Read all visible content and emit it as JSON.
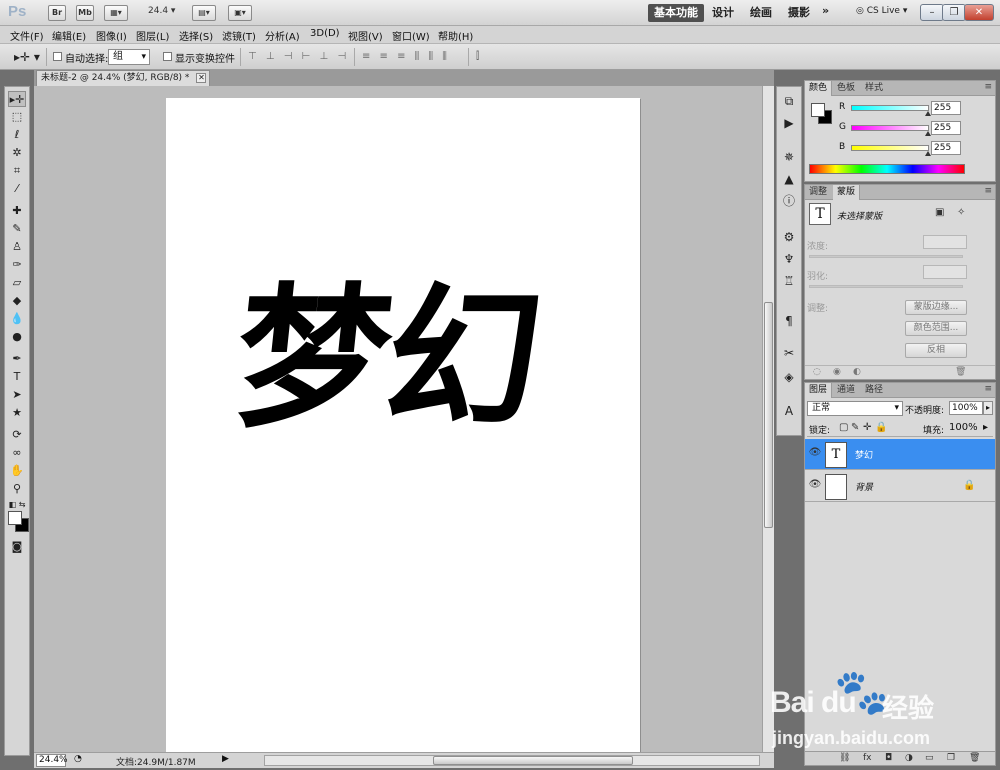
{
  "app": {
    "logo": "Ps",
    "bridge_btn": "Br",
    "minibridge_btn": "Mb",
    "zoom_select": "24.4",
    "workspaces": [
      {
        "label": "基本功能",
        "active": true
      },
      {
        "label": "设计",
        "active": false
      },
      {
        "label": "绘画",
        "active": false
      },
      {
        "label": "摄影",
        "active": false
      }
    ],
    "more": "»",
    "cs_live": "CS Live"
  },
  "menu": [
    "文件(F)",
    "编辑(E)",
    "图像(I)",
    "图层(L)",
    "选择(S)",
    "滤镜(T)",
    "分析(A)",
    "3D(D)",
    "视图(V)",
    "窗口(W)",
    "帮助(H)"
  ],
  "options": {
    "auto_select_label": "自动选择:",
    "auto_select_value": "组",
    "show_transform_label": "显示变换控件"
  },
  "document": {
    "tab_title": "未标题-2 @ 24.4% (梦幻, RGB/8) *",
    "text": "梦幻"
  },
  "status": {
    "zoom": "24.4%",
    "doc_info": "文档:24.9M/1.87M"
  },
  "color_panel": {
    "tabs": [
      "颜色",
      "色板",
      "样式"
    ],
    "channels": [
      {
        "name": "R",
        "value": "255",
        "gradient": "linear-gradient(90deg,#00ffff,#ffffff)"
      },
      {
        "name": "G",
        "value": "255",
        "gradient": "linear-gradient(90deg,#ff00ff,#ffffff)"
      },
      {
        "name": "B",
        "value": "255",
        "gradient": "linear-gradient(90deg,#ffff00,#ffffff)"
      }
    ]
  },
  "adjust_panel": {
    "tabs": [
      "调整",
      "蒙版"
    ],
    "no_mask": "未选择蒙版",
    "density": "浓度:",
    "feather": "羽化:",
    "refine": "调整:",
    "mask_edge": "蒙版边缘...",
    "color_range": "颜色范围...",
    "invert": "反相"
  },
  "layers_panel": {
    "tabs": [
      "图层",
      "通道",
      "路径"
    ],
    "blend_mode": "正常",
    "opacity_label": "不透明度:",
    "opacity": "100%",
    "lock_label": "锁定:",
    "fill_label": "填充:",
    "fill": "100%",
    "layers": [
      {
        "name": "梦幻",
        "thumb": "T",
        "selected": true,
        "locked": false
      },
      {
        "name": "背景",
        "thumb": "",
        "selected": false,
        "locked": true
      }
    ]
  },
  "watermark": {
    "logo": "Bai du",
    "cn": "经验",
    "url": "jingyan.baidu.com"
  },
  "colors": {
    "selection": "#3a8ef0",
    "workspace_bg": "#bcbcbc",
    "chrome": "#d6d6d6"
  }
}
